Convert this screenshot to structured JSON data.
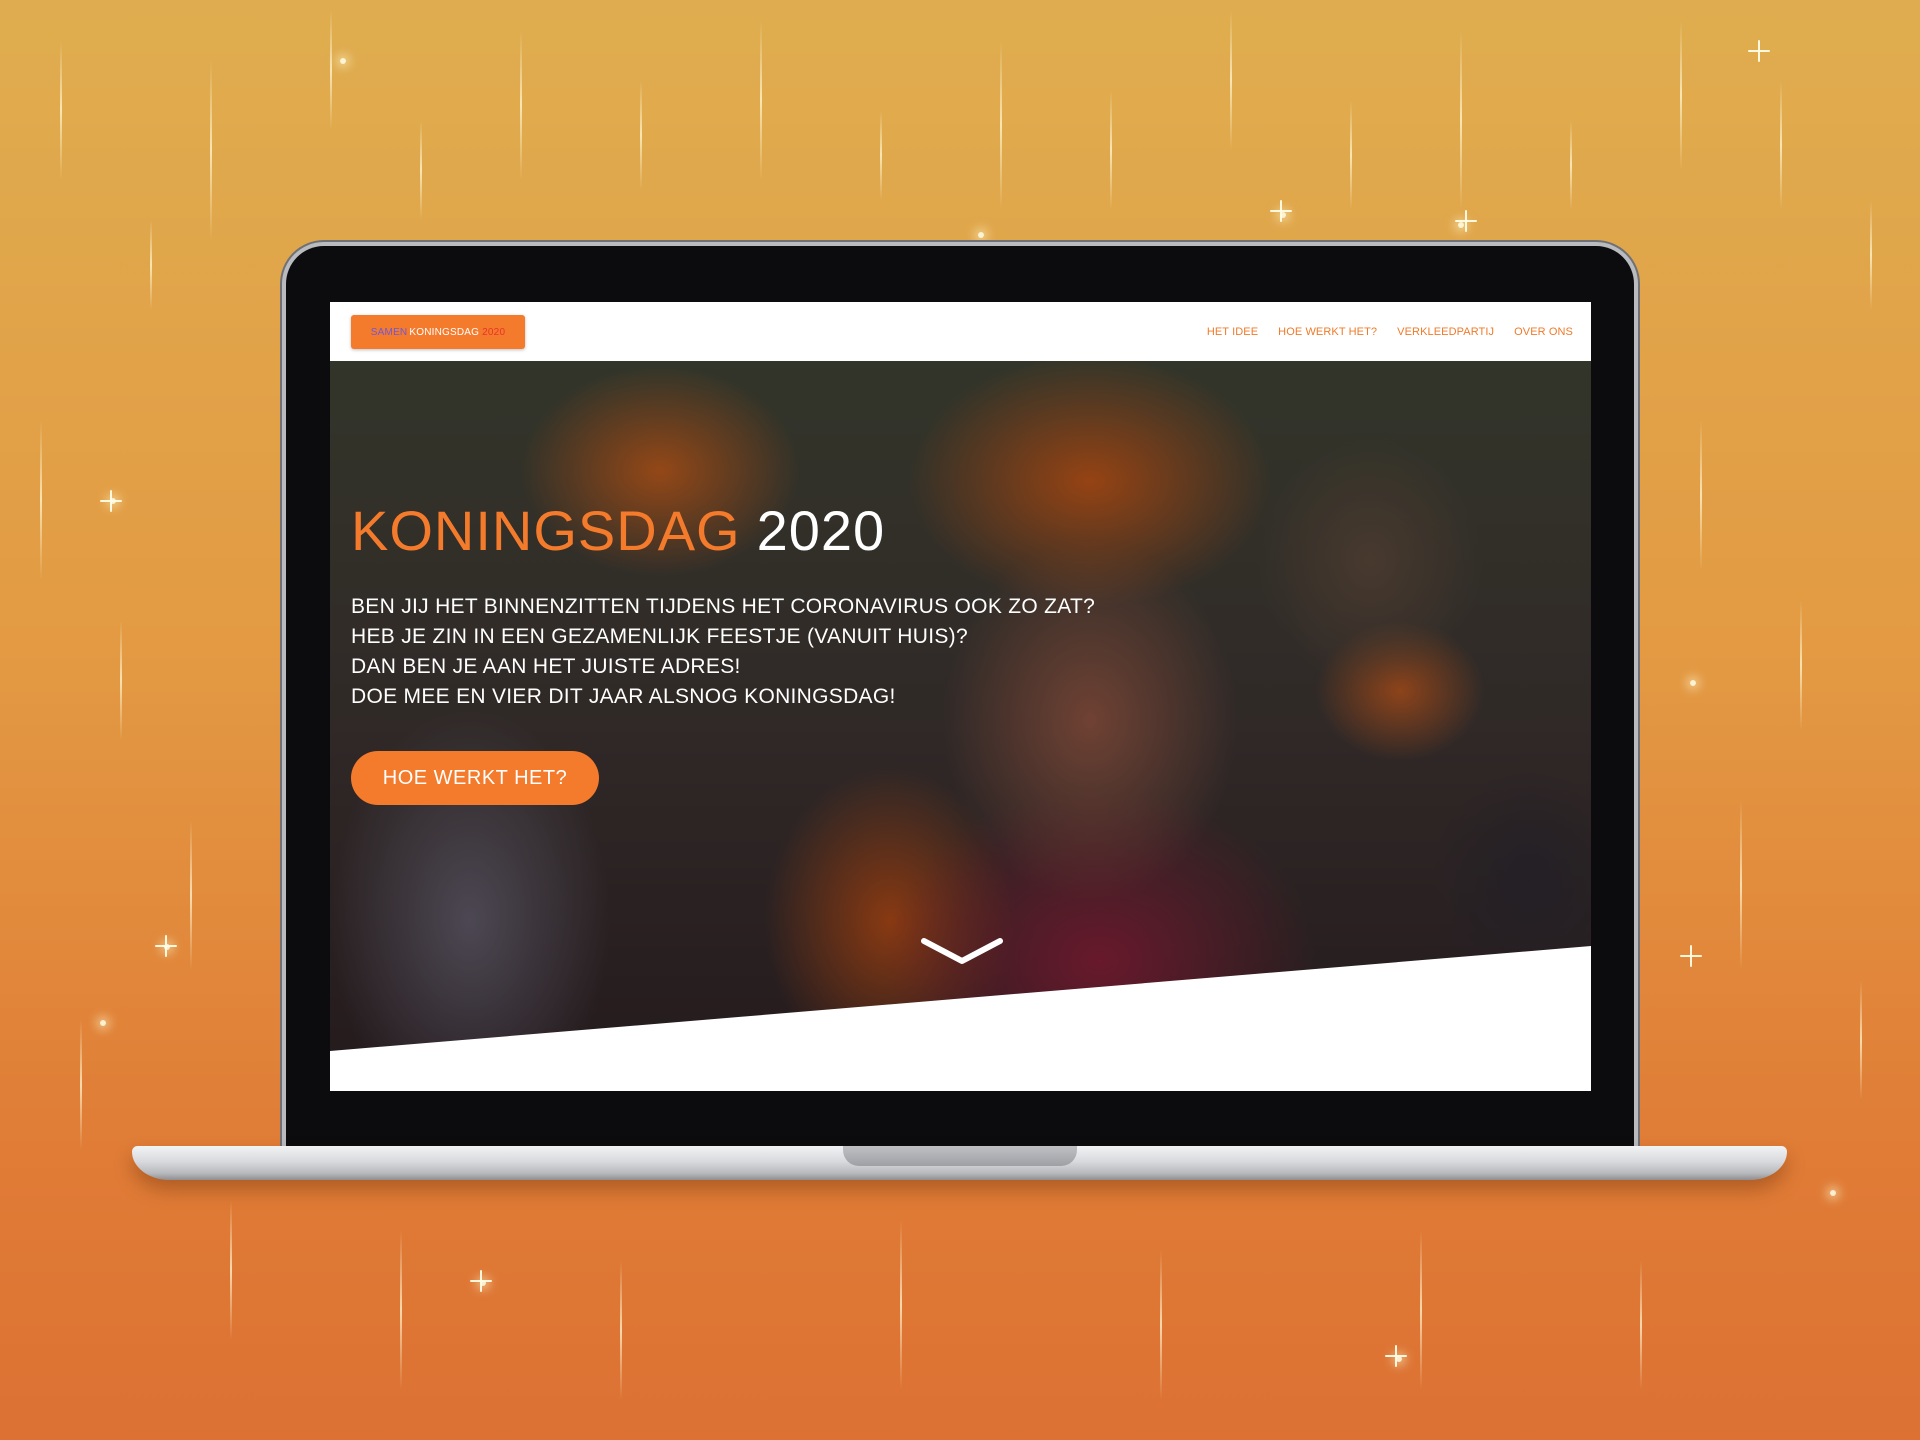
{
  "site": {
    "logo": {
      "part1": "SAMEN",
      "part2": "KONINGSDAG",
      "part3": "2020"
    },
    "nav": [
      {
        "label": "HET IDEE"
      },
      {
        "label": "HOE WERKT HET?"
      },
      {
        "label": "VERKLEEDPARTIJ"
      },
      {
        "label": "OVER ONS"
      }
    ]
  },
  "hero": {
    "title_part1": "KONINGSDAG",
    "title_part2": "2020",
    "lines": [
      "BEN JIJ HET BINNENZITTEN TIJDENS HET CORONAVIRUS OOK ZO ZAT?",
      "HEB JE ZIN IN EEN GEZAMENLIJK FEESTJE (VANUIT HUIS)?",
      "DAN BEN JE AAN HET JUISTE ADRES!",
      "DOE MEE EN VIER DIT JAAR ALSNOG KONINGSDAG!"
    ],
    "cta_label": "HOE WERKT HET?",
    "scroll_icon": "chevron-down-icon"
  },
  "colors": {
    "brand_orange": "#f47a2c",
    "logo_accent_purple": "#6f58d8",
    "logo_accent_red": "#e8352a",
    "background_gold": "#dfad4f",
    "background_orange": "#dc7133"
  }
}
